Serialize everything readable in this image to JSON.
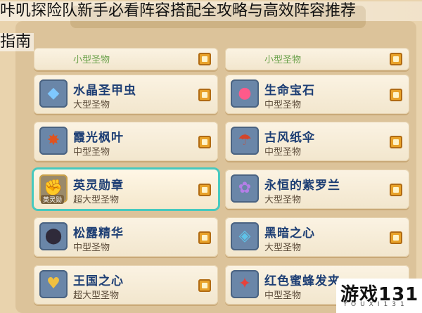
{
  "title": {
    "line1": "咔叽探险队新手必看阵容搭配全攻略与高效阵容推荐",
    "line2": "指南"
  },
  "items": [
    {
      "name": "",
      "type": "小型圣物",
      "icon": "sword-icon"
    },
    {
      "name": "",
      "type": "小型圣物",
      "icon": "pen-icon"
    },
    {
      "name": "水晶圣甲虫",
      "type": "大型圣物",
      "icon": "beetle-icon"
    },
    {
      "name": "生命宝石",
      "type": "中型圣物",
      "icon": "gem-icon"
    },
    {
      "name": "霞光枫叶",
      "type": "中型圣物",
      "icon": "leaf-icon"
    },
    {
      "name": "古风纸伞",
      "type": "中型圣物",
      "icon": "umbrella-icon"
    },
    {
      "name": "英灵勋章",
      "type": "超大型圣物",
      "icon": "medal-icon",
      "tag": "英灵勋",
      "highlighted": true
    },
    {
      "name": "永恒的紫罗兰",
      "type": "大型圣物",
      "icon": "violet-icon"
    },
    {
      "name": "松露精华",
      "type": "中型圣物",
      "icon": "truffle-icon"
    },
    {
      "name": "黑暗之心",
      "type": "大型圣物",
      "icon": "dark-heart-icon"
    },
    {
      "name": "王国之心",
      "type": "超大型圣物",
      "icon": "kingdom-heart-icon"
    },
    {
      "name": "红色蜜蜂发夹",
      "type": "中型圣物",
      "icon": "bee-clip-icon"
    }
  ],
  "watermark": {
    "main": "游戏131",
    "sub": "YOUXI131"
  }
}
